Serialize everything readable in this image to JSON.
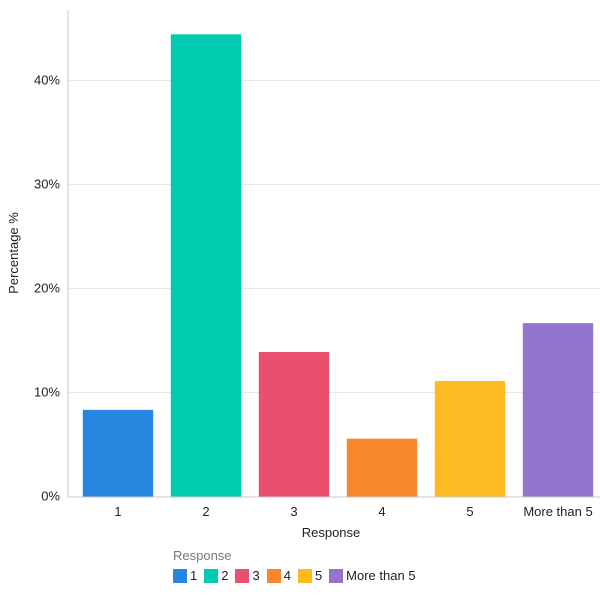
{
  "chart_data": {
    "type": "bar",
    "title": "",
    "xlabel": "Response",
    "ylabel": "Percentage %",
    "categories": [
      "1",
      "2",
      "3",
      "4",
      "5",
      "More than 5"
    ],
    "values": [
      8.33,
      44.44,
      13.89,
      5.56,
      11.11,
      16.67
    ],
    "colors": [
      "#2587e0",
      "#00cbb1",
      "#e94f6e",
      "#f7882c",
      "#fdbb21",
      "#9374cd"
    ],
    "ylim": [
      0,
      46.5
    ],
    "yticks": [
      0,
      10,
      20,
      30,
      40
    ],
    "ytick_labels": [
      "0%",
      "10%",
      "20%",
      "30%",
      "40%"
    ],
    "grid": true,
    "legend": {
      "title": "Response",
      "placement": "bottom-center",
      "entries": [
        "1",
        "2",
        "3",
        "4",
        "5",
        "More than 5"
      ]
    }
  }
}
